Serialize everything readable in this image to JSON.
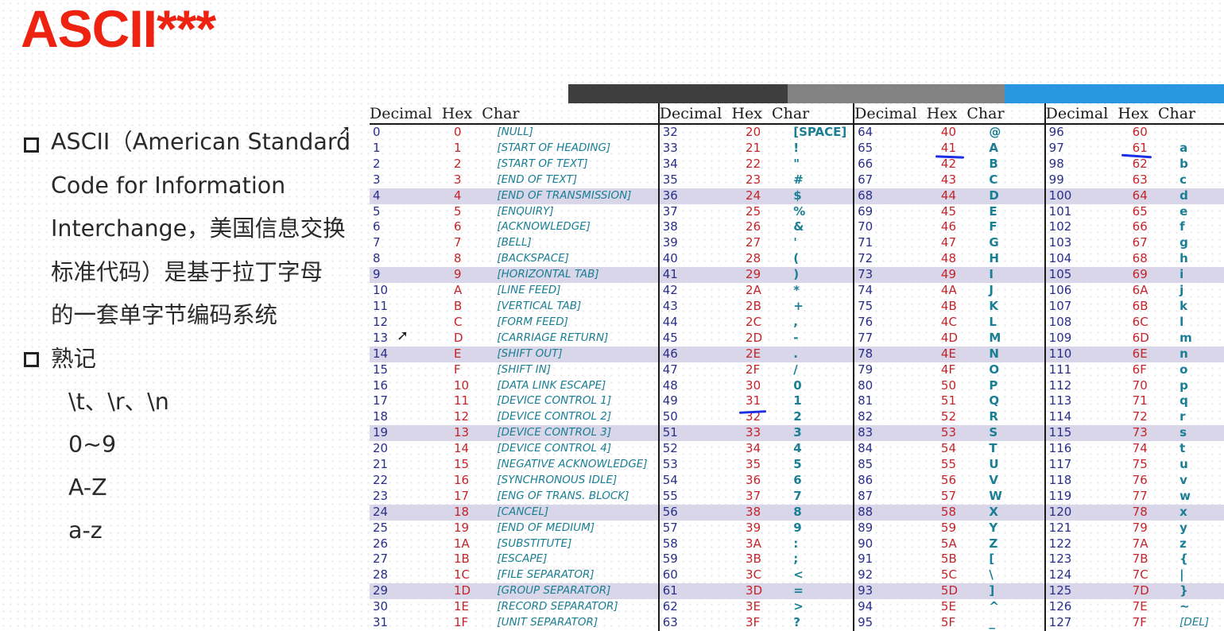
{
  "title": "ASCII***",
  "bullets": [
    {
      "lines": [
        "ASCII（American Standard",
        "Code for Information",
        "Interchange，美国信息交换",
        "标准代码）是基于拉丁字母",
        "的一套单字节编码系统"
      ]
    },
    {
      "lines": [
        "熟记"
      ],
      "subitems": [
        "\\t、\\r、\\n",
        "0~9",
        "A-Z",
        "a-z"
      ]
    }
  ],
  "table": {
    "headers": [
      "Decimal  Hex  Char",
      "Decimal  Hex  Char",
      "Decimal  Hex  Char",
      "Decimal  Hex  Char"
    ],
    "highlight_color": "#d8d6e8",
    "rows": [
      [
        "0",
        "0",
        "[NULL]",
        "32",
        "20",
        "[SPACE]",
        "64",
        "40",
        "@",
        "96",
        "60",
        ""
      ],
      [
        "1",
        "1",
        "[START OF HEADING]",
        "33",
        "21",
        "!",
        "65",
        "41",
        "A",
        "97",
        "61",
        "a"
      ],
      [
        "2",
        "2",
        "[START OF TEXT]",
        "34",
        "22",
        "\"",
        "66",
        "42",
        "B",
        "98",
        "62",
        "b"
      ],
      [
        "3",
        "3",
        "[END OF TEXT]",
        "35",
        "23",
        "#",
        "67",
        "43",
        "C",
        "99",
        "63",
        "c"
      ],
      [
        "4",
        "4",
        "[END OF TRANSMISSION]",
        "36",
        "24",
        "$",
        "68",
        "44",
        "D",
        "100",
        "64",
        "d"
      ],
      [
        "5",
        "5",
        "[ENQUIRY]",
        "37",
        "25",
        "%",
        "69",
        "45",
        "E",
        "101",
        "65",
        "e"
      ],
      [
        "6",
        "6",
        "[ACKNOWLEDGE]",
        "38",
        "26",
        "&",
        "70",
        "46",
        "F",
        "102",
        "66",
        "f"
      ],
      [
        "7",
        "7",
        "[BELL]",
        "39",
        "27",
        "'",
        "71",
        "47",
        "G",
        "103",
        "67",
        "g"
      ],
      [
        "8",
        "8",
        "[BACKSPACE]",
        "40",
        "28",
        "(",
        "72",
        "48",
        "H",
        "104",
        "68",
        "h"
      ],
      [
        "9",
        "9",
        "[HORIZONTAL TAB]",
        "41",
        "29",
        ")",
        "73",
        "49",
        "I",
        "105",
        "69",
        "i"
      ],
      [
        "10",
        "A",
        "[LINE FEED]",
        "42",
        "2A",
        "*",
        "74",
        "4A",
        "J",
        "106",
        "6A",
        "j"
      ],
      [
        "11",
        "B",
        "[VERTICAL TAB]",
        "43",
        "2B",
        "+",
        "75",
        "4B",
        "K",
        "107",
        "6B",
        "k"
      ],
      [
        "12",
        "C",
        "[FORM FEED]",
        "44",
        "2C",
        ",",
        "76",
        "4C",
        "L",
        "108",
        "6C",
        "l"
      ],
      [
        "13",
        "D",
        "[CARRIAGE RETURN]",
        "45",
        "2D",
        "-",
        "77",
        "4D",
        "M",
        "109",
        "6D",
        "m"
      ],
      [
        "14",
        "E",
        "[SHIFT OUT]",
        "46",
        "2E",
        ".",
        "78",
        "4E",
        "N",
        "110",
        "6E",
        "n"
      ],
      [
        "15",
        "F",
        "[SHIFT IN]",
        "47",
        "2F",
        "/",
        "79",
        "4F",
        "O",
        "111",
        "6F",
        "o"
      ],
      [
        "16",
        "10",
        "[DATA LINK ESCAPE]",
        "48",
        "30",
        "0",
        "80",
        "50",
        "P",
        "112",
        "70",
        "p"
      ],
      [
        "17",
        "11",
        "[DEVICE CONTROL 1]",
        "49",
        "31",
        "1",
        "81",
        "51",
        "Q",
        "113",
        "71",
        "q"
      ],
      [
        "18",
        "12",
        "[DEVICE CONTROL 2]",
        "50",
        "32",
        "2",
        "82",
        "52",
        "R",
        "114",
        "72",
        "r"
      ],
      [
        "19",
        "13",
        "[DEVICE CONTROL 3]",
        "51",
        "33",
        "3",
        "83",
        "53",
        "S",
        "115",
        "73",
        "s"
      ],
      [
        "20",
        "14",
        "[DEVICE CONTROL 4]",
        "52",
        "34",
        "4",
        "84",
        "54",
        "T",
        "116",
        "74",
        "t"
      ],
      [
        "21",
        "15",
        "[NEGATIVE ACKNOWLEDGE]",
        "53",
        "35",
        "5",
        "85",
        "55",
        "U",
        "117",
        "75",
        "u"
      ],
      [
        "22",
        "16",
        "[SYNCHRONOUS IDLE]",
        "54",
        "36",
        "6",
        "86",
        "56",
        "V",
        "118",
        "76",
        "v"
      ],
      [
        "23",
        "17",
        "[ENG OF TRANS. BLOCK]",
        "55",
        "37",
        "7",
        "87",
        "57",
        "W",
        "119",
        "77",
        "w"
      ],
      [
        "24",
        "18",
        "[CANCEL]",
        "56",
        "38",
        "8",
        "88",
        "58",
        "X",
        "120",
        "78",
        "x"
      ],
      [
        "25",
        "19",
        "[END OF MEDIUM]",
        "57",
        "39",
        "9",
        "89",
        "59",
        "Y",
        "121",
        "79",
        "y"
      ],
      [
        "26",
        "1A",
        "[SUBSTITUTE]",
        "58",
        "3A",
        ":",
        "90",
        "5A",
        "Z",
        "122",
        "7A",
        "z"
      ],
      [
        "27",
        "1B",
        "[ESCAPE]",
        "59",
        "3B",
        ";",
        "91",
        "5B",
        "[",
        "123",
        "7B",
        "{"
      ],
      [
        "28",
        "1C",
        "[FILE SEPARATOR]",
        "60",
        "3C",
        "<",
        "92",
        "5C",
        "\\",
        "124",
        "7C",
        "|"
      ],
      [
        "29",
        "1D",
        "[GROUP SEPARATOR]",
        "61",
        "3D",
        "=",
        "93",
        "5D",
        "]",
        "125",
        "7D",
        "}"
      ],
      [
        "30",
        "1E",
        "[RECORD SEPARATOR]",
        "62",
        "3E",
        ">",
        "94",
        "5E",
        "^",
        "126",
        "7E",
        "~"
      ],
      [
        "31",
        "1F",
        "[UNIT SEPARATOR]",
        "63",
        "3F",
        "?",
        "95",
        "5F",
        "_",
        "127",
        "7F",
        "[DEL]"
      ]
    ]
  }
}
